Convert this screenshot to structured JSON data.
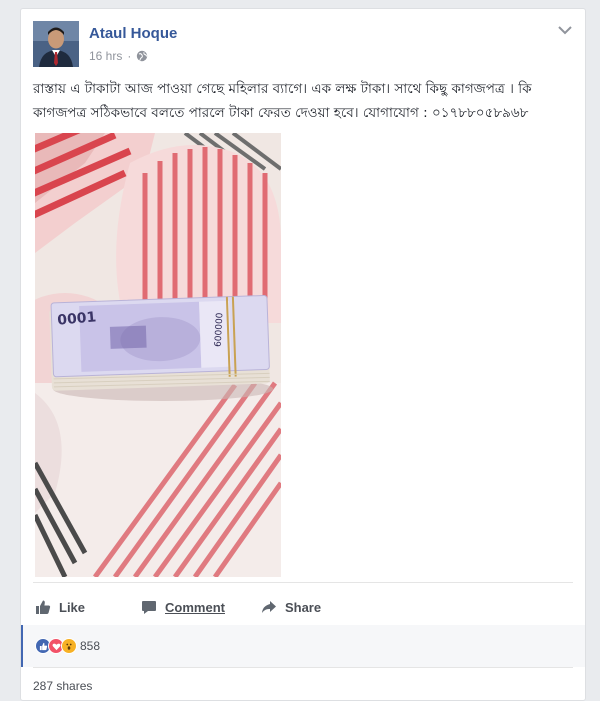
{
  "post": {
    "author": "Ataul Hoque",
    "time": "16 hrs",
    "separator": "·",
    "text": "রাস্তায় এ টাকাটা আজ পাওয়া গেছে মহিলার ব্যাগে। এক লক্ষ টাকা। সাথে কিছু কাগজপত্র । কি কাগজপত্র সঠিকভাবে বলতে পারলে টাকা ফেরত দেওয়া হবে। যোগাযোগ : ০১৭৮৮০৫৮৯৬৮"
  },
  "actions": {
    "like": "Like",
    "comment": "Comment",
    "share": "Share"
  },
  "reactions": {
    "count": "858",
    "types": [
      "like-icon",
      "love-icon",
      "wow-icon"
    ]
  },
  "shares": {
    "label": "287 shares"
  },
  "colors": {
    "link": "#365899",
    "like_blue": "#4267b2",
    "love_red": "#f25268",
    "wow_yellow": "#f7b125"
  }
}
